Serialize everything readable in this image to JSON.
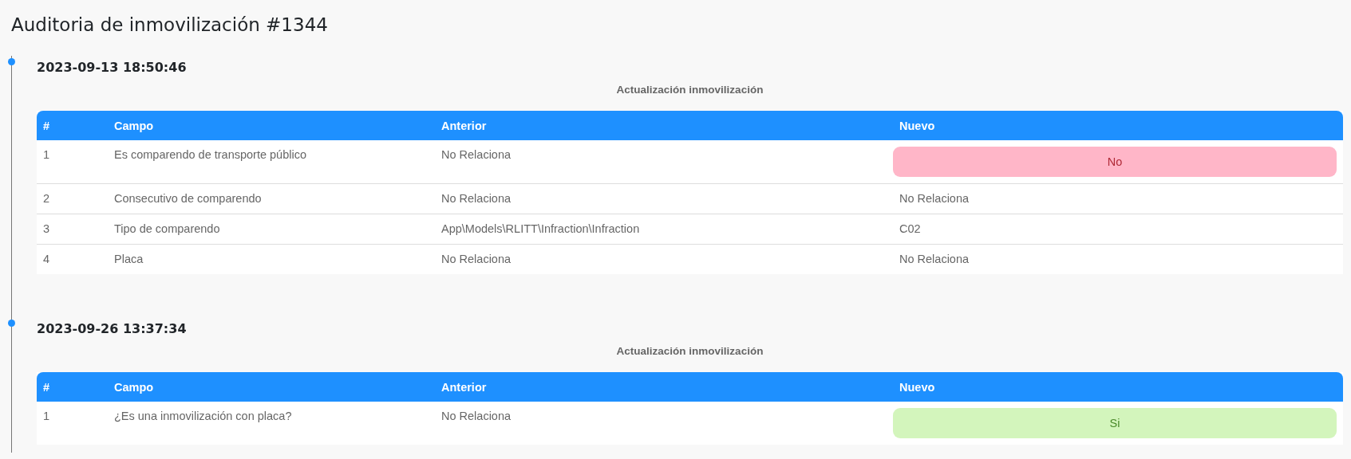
{
  "page": {
    "title": "Auditoria de inmovilización #1344"
  },
  "entries": [
    {
      "timestamp": "2023-09-13 18:50:46",
      "subtitle": "Actualización inmovilización",
      "columns": [
        "#",
        "Campo",
        "Anterior",
        "Nuevo"
      ],
      "rows": [
        {
          "index": "1",
          "field": "Es comparendo de transporte público",
          "previous": "No Relaciona",
          "new": {
            "kind": "badge",
            "color": "#ffb6c8",
            "text": "No"
          }
        },
        {
          "index": "2",
          "field": "Consecutivo de comparendo",
          "previous": "No Relaciona",
          "new": {
            "kind": "text",
            "text": "No Relaciona"
          }
        },
        {
          "index": "3",
          "field": "Tipo de comparendo",
          "previous": "App\\Models\\RLITT\\Infraction\\Infraction",
          "new": {
            "kind": "text",
            "text": "C02"
          }
        },
        {
          "index": "4",
          "field": "Placa",
          "previous": "No Relaciona",
          "new": {
            "kind": "text",
            "text": "No Relaciona"
          }
        }
      ]
    },
    {
      "timestamp": "2023-09-26 13:37:34",
      "subtitle": "Actualización inmovilización",
      "columns": [
        "#",
        "Campo",
        "Anterior",
        "Nuevo"
      ],
      "rows": [
        {
          "index": "1",
          "field": "¿Es una inmovilización con placa?",
          "previous": "No Relaciona",
          "new": {
            "kind": "badge",
            "color": "#d3f5bc",
            "text": "Si"
          }
        }
      ]
    }
  ]
}
